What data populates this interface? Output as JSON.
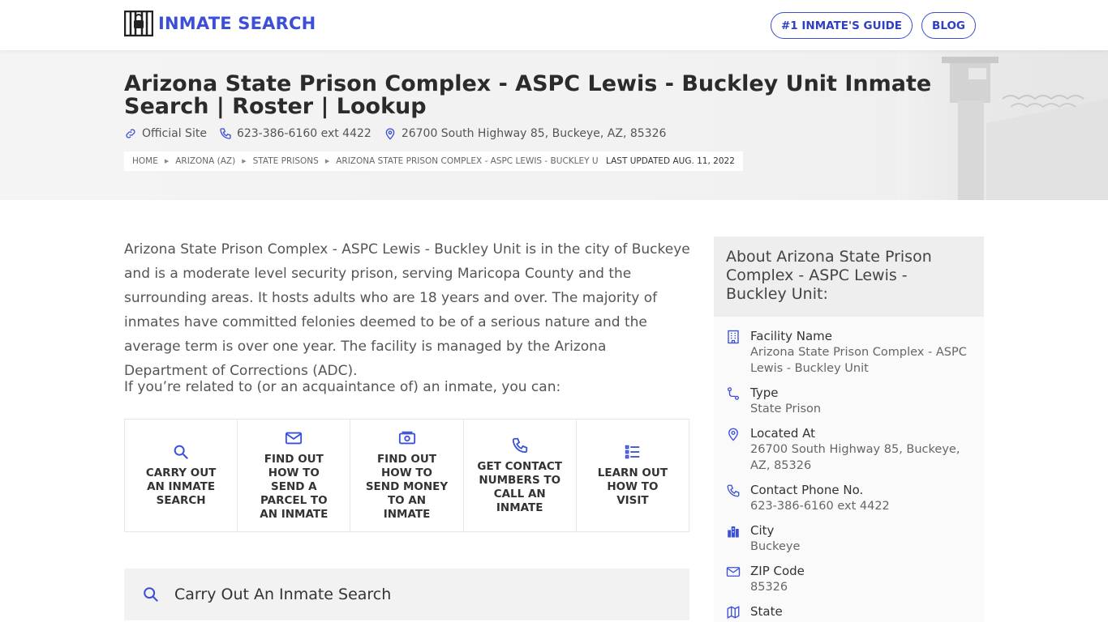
{
  "header": {
    "logo_text": "INMATE SEARCH",
    "nav": [
      "#1 INMATE'S GUIDE",
      "BLOG"
    ],
    "accent": "#3b4fd9"
  },
  "hero": {
    "title": "Arizona State Prison Complex - ASPC Lewis - Buckley Unit Inmate Search | Roster | Lookup",
    "official_site": "Official Site",
    "phone": "623-386-6160 ext 4422",
    "address": "26700 South Highway 85, Buckeye, AZ, 85326",
    "breadcrumbs": [
      "HOME",
      "ARIZONA (AZ)",
      "STATE PRISONS",
      "ARIZONA STATE PRISON COMPLEX - ASPC LEWIS - BUCKLEY UNIT"
    ],
    "last_updated": "LAST UPDATED AUG. 11, 2022"
  },
  "main": {
    "intro": "Arizona State Prison Complex - ASPC Lewis - Buckley Unit is in the city of Buckeye and is a moderate level security prison, serving Maricopa County and the surrounding areas. It hosts adults who are 18 years and over. The majority of inmates have committed felonies deemed to be of a serious nature and the average term is over one year. The facility is managed by the Arizona Department of Corrections (ADC).",
    "lead": "If you’re related to (or an acquaintance of) an inmate, you can:",
    "actions": [
      {
        "label": "CARRY OUT AN INMATE SEARCH",
        "icon": "search-icon"
      },
      {
        "label": "FIND OUT HOW TO SEND A PARCEL TO AN INMATE",
        "icon": "mail-icon"
      },
      {
        "label": "FIND OUT HOW TO SEND MONEY TO AN INMATE",
        "icon": "money-icon"
      },
      {
        "label": "GET CONTACT NUMBERS TO CALL AN INMATE",
        "icon": "phone-icon"
      },
      {
        "label": "LEARN OUT HOW TO VISIT",
        "icon": "list-icon"
      }
    ],
    "search_section_title": "Carry Out An Inmate Search"
  },
  "sidebar": {
    "title": "About Arizona State Prison Complex - ASPC Lewis - Buckley Unit:",
    "items": [
      {
        "key": "Facility Name",
        "value": "Arizona State Prison Complex - ASPC Lewis - Buckley Unit",
        "icon": "building-icon"
      },
      {
        "key": "Type",
        "value": "State Prison",
        "icon": "route-icon"
      },
      {
        "key": "Located At",
        "value": "26700 South Highway 85, Buckeye, AZ, 85326",
        "icon": "pin-icon"
      },
      {
        "key": "Contact Phone No.",
        "value": "623-386-6160 ext 4422",
        "icon": "phone-icon"
      },
      {
        "key": "City",
        "value": "Buckeye",
        "icon": "city-icon"
      },
      {
        "key": "ZIP Code",
        "value": "85326",
        "icon": "mail-icon"
      },
      {
        "key": "State",
        "value": "",
        "icon": "map-icon"
      }
    ]
  }
}
